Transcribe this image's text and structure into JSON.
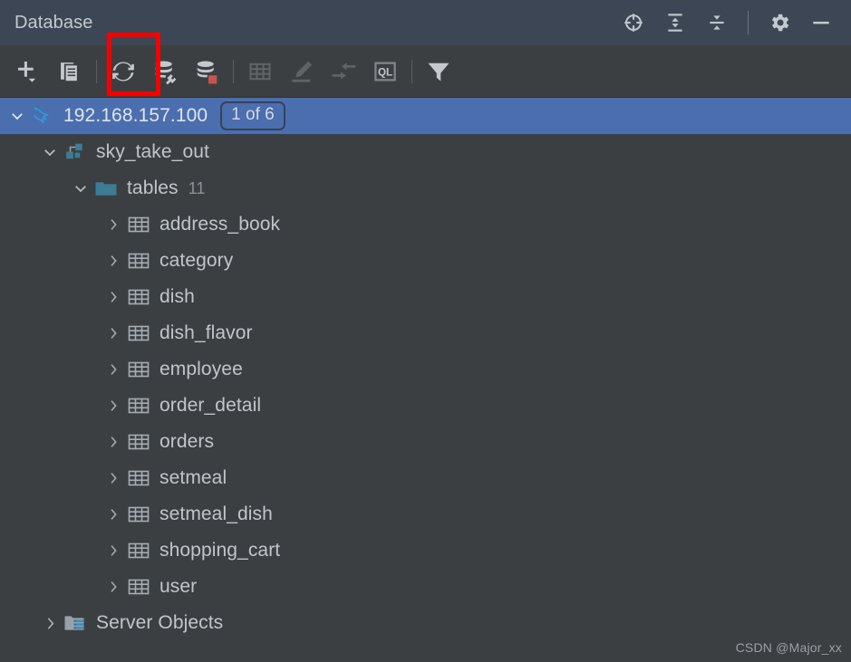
{
  "window": {
    "title": "Database",
    "title_actions": [
      {
        "name": "locate-in-tree-icon",
        "label": "Scroll from Source"
      },
      {
        "name": "expand-all-icon",
        "label": "Expand All"
      },
      {
        "name": "collapse-all-icon",
        "label": "Collapse All"
      },
      {
        "name": "gear-icon",
        "label": "Options"
      },
      {
        "name": "minimize-icon",
        "label": "Hide"
      }
    ]
  },
  "toolbar": {
    "items": [
      {
        "name": "add-data-source-button",
        "icon": "plus-dropdown-icon",
        "label": "New",
        "enabled": true,
        "highlighted": false
      },
      {
        "name": "duplicate-button",
        "icon": "copy-icon",
        "label": "Duplicate",
        "enabled": true,
        "highlighted": false
      },
      {
        "name": "separator-1",
        "icon": "separator",
        "label": "",
        "enabled": true,
        "highlighted": false
      },
      {
        "name": "refresh-button",
        "icon": "refresh-icon",
        "label": "Refresh",
        "enabled": true,
        "highlighted": true
      },
      {
        "name": "data-source-properties-button",
        "icon": "database-wrench-icon",
        "label": "Data Source Properties",
        "enabled": true,
        "highlighted": false
      },
      {
        "name": "manage-data-sources-button",
        "icon": "database-stop-icon",
        "label": "Disconnect",
        "enabled": true,
        "highlighted": false
      },
      {
        "name": "separator-2",
        "icon": "separator",
        "label": "",
        "enabled": true,
        "highlighted": false
      },
      {
        "name": "open-table-editor-button",
        "icon": "table-icon",
        "label": "Table Editor",
        "enabled": false,
        "highlighted": false
      },
      {
        "name": "modify-object-button",
        "icon": "pencil-icon",
        "label": "Modify Object",
        "enabled": false,
        "highlighted": false
      },
      {
        "name": "jump-to-editor-button",
        "icon": "jump-to-icon",
        "label": "Jump to Editor",
        "enabled": false,
        "highlighted": false
      },
      {
        "name": "open-query-console-button",
        "icon": "ql-icon",
        "label": "Open Query Console",
        "enabled": false,
        "highlighted": false
      },
      {
        "name": "separator-3",
        "icon": "separator",
        "label": "",
        "enabled": true,
        "highlighted": false
      },
      {
        "name": "filter-button",
        "icon": "filter-icon",
        "label": "Filter",
        "enabled": true,
        "highlighted": false
      }
    ],
    "highlight_color": "#f80000"
  },
  "tree": {
    "rows": [
      {
        "name": "tree-item-data-source",
        "label": "192.168.157.100",
        "icon": "mysql-dolphin-icon",
        "indent": 1,
        "arrow": "chevron-down",
        "selected": true,
        "badge": "1 of 6",
        "count": ""
      },
      {
        "name": "tree-item-schema",
        "label": "sky_take_out",
        "icon": "schema-icon",
        "indent": 2,
        "arrow": "chevron-down",
        "selected": false,
        "badge": "",
        "count": ""
      },
      {
        "name": "tree-item-tables-folder",
        "label": "tables",
        "icon": "folder-icon",
        "indent": 3,
        "arrow": "chevron-down",
        "selected": false,
        "badge": "",
        "count": "11"
      },
      {
        "name": "tree-item-table",
        "label": "address_book",
        "icon": "table-grid-icon",
        "indent": 4,
        "arrow": "chevron-right",
        "selected": false,
        "badge": "",
        "count": ""
      },
      {
        "name": "tree-item-table",
        "label": "category",
        "icon": "table-grid-icon",
        "indent": 4,
        "arrow": "chevron-right",
        "selected": false,
        "badge": "",
        "count": ""
      },
      {
        "name": "tree-item-table",
        "label": "dish",
        "icon": "table-grid-icon",
        "indent": 4,
        "arrow": "chevron-right",
        "selected": false,
        "badge": "",
        "count": ""
      },
      {
        "name": "tree-item-table",
        "label": "dish_flavor",
        "icon": "table-grid-icon",
        "indent": 4,
        "arrow": "chevron-right",
        "selected": false,
        "badge": "",
        "count": ""
      },
      {
        "name": "tree-item-table",
        "label": "employee",
        "icon": "table-grid-icon",
        "indent": 4,
        "arrow": "chevron-right",
        "selected": false,
        "badge": "",
        "count": ""
      },
      {
        "name": "tree-item-table",
        "label": "order_detail",
        "icon": "table-grid-icon",
        "indent": 4,
        "arrow": "chevron-right",
        "selected": false,
        "badge": "",
        "count": ""
      },
      {
        "name": "tree-item-table",
        "label": "orders",
        "icon": "table-grid-icon",
        "indent": 4,
        "arrow": "chevron-right",
        "selected": false,
        "badge": "",
        "count": ""
      },
      {
        "name": "tree-item-table",
        "label": "setmeal",
        "icon": "table-grid-icon",
        "indent": 4,
        "arrow": "chevron-right",
        "selected": false,
        "badge": "",
        "count": ""
      },
      {
        "name": "tree-item-table",
        "label": "setmeal_dish",
        "icon": "table-grid-icon",
        "indent": 4,
        "arrow": "chevron-right",
        "selected": false,
        "badge": "",
        "count": ""
      },
      {
        "name": "tree-item-table",
        "label": "shopping_cart",
        "icon": "table-grid-icon",
        "indent": 4,
        "arrow": "chevron-right",
        "selected": false,
        "badge": "",
        "count": ""
      },
      {
        "name": "tree-item-table",
        "label": "user",
        "icon": "table-grid-icon",
        "indent": 4,
        "arrow": "chevron-right",
        "selected": false,
        "badge": "",
        "count": ""
      },
      {
        "name": "tree-item-server-objects",
        "label": "Server Objects",
        "icon": "server-objects-icon",
        "indent": 2,
        "arrow": "chevron-right",
        "selected": false,
        "badge": "",
        "count": ""
      }
    ]
  },
  "watermark": {
    "text": "CSDN @Major_xx"
  },
  "colors": {
    "titlebar_bg": "#3d4654",
    "toolbar_bg": "#3c3f41",
    "selection_bg": "#4b6eaf",
    "accent_teal": "#3b7c96",
    "highlight_red": "#f80000",
    "text": "#bfc6cc"
  }
}
